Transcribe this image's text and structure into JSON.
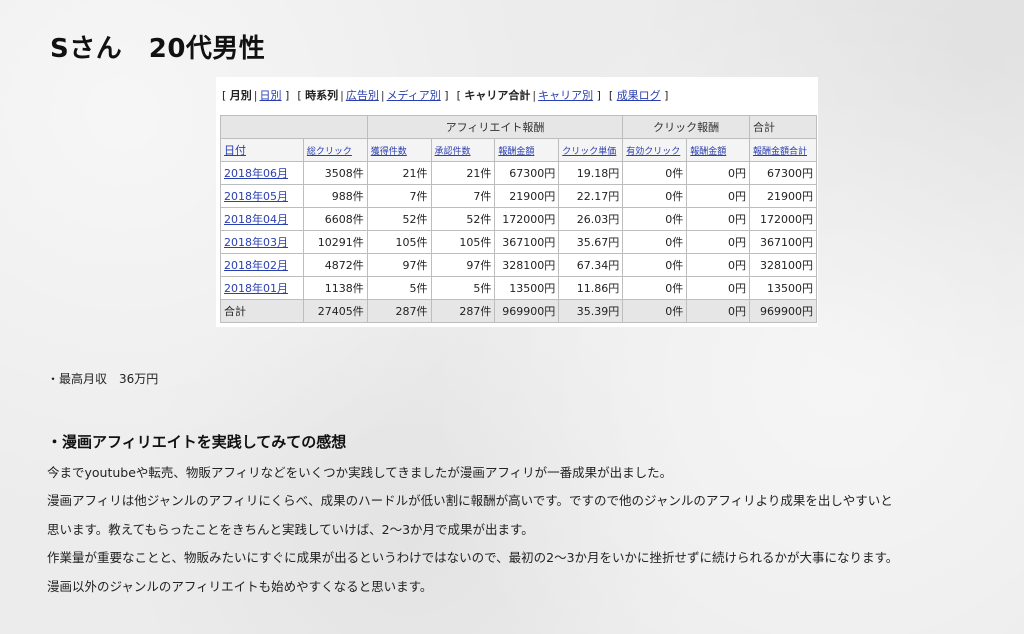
{
  "page_title": "Sさん　20代男性",
  "report_nav": {
    "monthly": "月別",
    "daily": "日別",
    "timeline": "時系列",
    "by_ad": "広告別",
    "by_media": "メディア別",
    "career_total": "キャリア合計",
    "by_career": "キャリア別",
    "result_log": "成果ログ"
  },
  "table": {
    "group_headers": {
      "affiliate": "アフィリエイト報酬",
      "click": "クリック報酬",
      "total": "合計"
    },
    "columns": [
      "日付",
      "総クリック",
      "獲得件数",
      "承認件数",
      "報酬金額",
      "クリック単価",
      "有効クリック",
      "報酬金額",
      "報酬金額合計"
    ],
    "rows": [
      [
        "2018年06月",
        "3508件",
        "21件",
        "21件",
        "67300円",
        "19.18円",
        "0件",
        "0円",
        "67300円"
      ],
      [
        "2018年05月",
        "988件",
        "7件",
        "7件",
        "21900円",
        "22.17円",
        "0件",
        "0円",
        "21900円"
      ],
      [
        "2018年04月",
        "6608件",
        "52件",
        "52件",
        "172000円",
        "26.03円",
        "0件",
        "0円",
        "172000円"
      ],
      [
        "2018年03月",
        "10291件",
        "105件",
        "105件",
        "367100円",
        "35.67円",
        "0件",
        "0円",
        "367100円"
      ],
      [
        "2018年02月",
        "4872件",
        "97件",
        "97件",
        "328100円",
        "67.34円",
        "0件",
        "0円",
        "328100円"
      ],
      [
        "2018年01月",
        "1138件",
        "5件",
        "5件",
        "13500円",
        "11.86円",
        "0件",
        "0円",
        "13500円"
      ]
    ],
    "total_row": [
      "合計",
      "27405件",
      "287件",
      "287件",
      "969900円",
      "35.39円",
      "0件",
      "0円",
      "969900円"
    ]
  },
  "max_income": "・最高月収　36万円",
  "section_title": "・漫画アフィリエイトを実践してみての感想",
  "paragraphs": [
    "今までyoutubeや転売、物販アフィリなどをいくつか実践してきましたが漫画アフィリが一番成果が出ました。",
    "漫画アフィリは他ジャンルのアフィリにくらべ、成果のハードルが低い割に報酬が高いです。ですので他のジャンルのアフィリより成果を出しやすいと",
    "思います。教えてもらったことをきちんと実践していけば、2〜3か月で成果が出ます。",
    "作業量が重要なことと、物販みたいにすぐに成果が出るというわけではないので、最初の2〜3か月をいかに挫折せずに続けられるかが大事になります。",
    "漫画以外のジャンルのアフィリエイトも始めやすくなると思います。"
  ]
}
